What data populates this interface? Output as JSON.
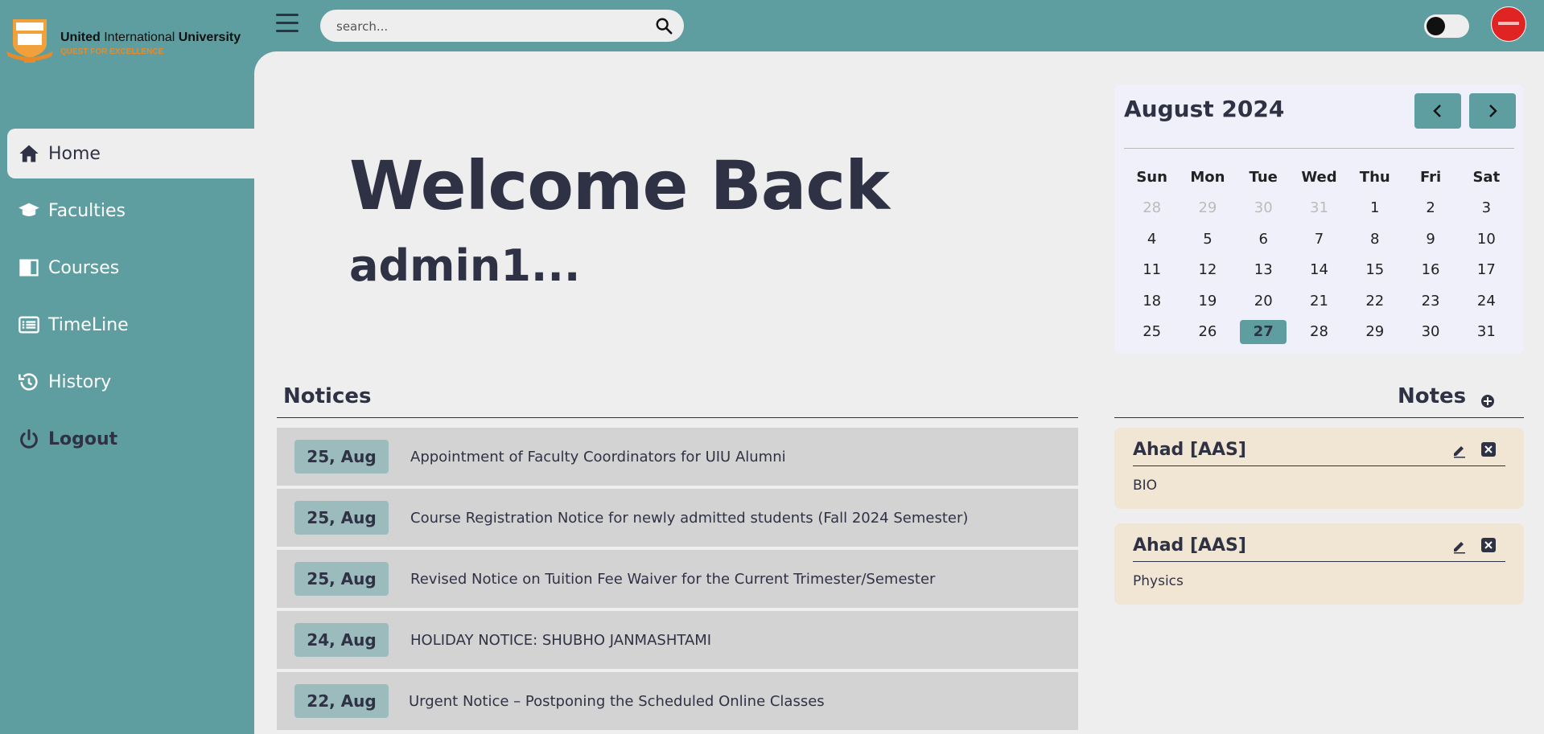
{
  "header": {
    "logo": {
      "title_bold_1": "United",
      "title_regular": "International",
      "title_bold_2": "University",
      "tagline": "QUEST FOR EXCELLENCE"
    },
    "search": {
      "placeholder": "search..."
    }
  },
  "sidebar": {
    "items": [
      {
        "label": "Home",
        "icon": "home-icon",
        "active": true
      },
      {
        "label": "Faculties",
        "icon": "graduation-cap-icon"
      },
      {
        "label": "Courses",
        "icon": "book-icon"
      },
      {
        "label": "TimeLine",
        "icon": "list-icon"
      },
      {
        "label": "History",
        "icon": "history-icon"
      },
      {
        "label": "Logout",
        "icon": "power-icon"
      }
    ]
  },
  "welcome": {
    "heading": "Welcome Back",
    "username": "admin1..."
  },
  "notices": {
    "title": "Notices",
    "items": [
      {
        "date": "25, Aug",
        "text": "Appointment of Faculty Coordinators for UIU Alumni"
      },
      {
        "date": "25, Aug",
        "text": "Course Registration Notice for newly admitted students (Fall 2024 Semester)"
      },
      {
        "date": "25, Aug",
        "text": "Revised Notice on Tuition Fee Waiver for the Current Trimester/Semester"
      },
      {
        "date": "24, Aug",
        "text": "HOLIDAY NOTICE: SHUBHO JANMASHTAMI"
      },
      {
        "date": "22, Aug",
        "text": "Urgent Notice – Postponing the Scheduled Online Classes"
      }
    ]
  },
  "calendar": {
    "month_label": "August 2024",
    "weekdays": [
      "Sun",
      "Mon",
      "Tue",
      "Wed",
      "Thu",
      "Fri",
      "Sat"
    ],
    "weeks": [
      [
        "28",
        "29",
        "30",
        "31",
        "1",
        "2",
        "3"
      ],
      [
        "4",
        "5",
        "6",
        "7",
        "8",
        "9",
        "10"
      ],
      [
        "11",
        "12",
        "13",
        "14",
        "15",
        "16",
        "17"
      ],
      [
        "18",
        "19",
        "20",
        "21",
        "22",
        "23",
        "24"
      ],
      [
        "25",
        "26",
        "27",
        "28",
        "29",
        "30",
        "31"
      ]
    ],
    "today": "27"
  },
  "notes": {
    "title": "Notes",
    "items": [
      {
        "author": "Ahad [AAS]",
        "body": "BIO"
      },
      {
        "author": "Ahad [AAS]",
        "body": "Physics"
      }
    ]
  },
  "colors": {
    "accent": "#5f9ea0",
    "text": "#2f3245",
    "panel": "#eeeeee",
    "note_bg": "#f1e5d3",
    "avatar": "#e02424"
  }
}
